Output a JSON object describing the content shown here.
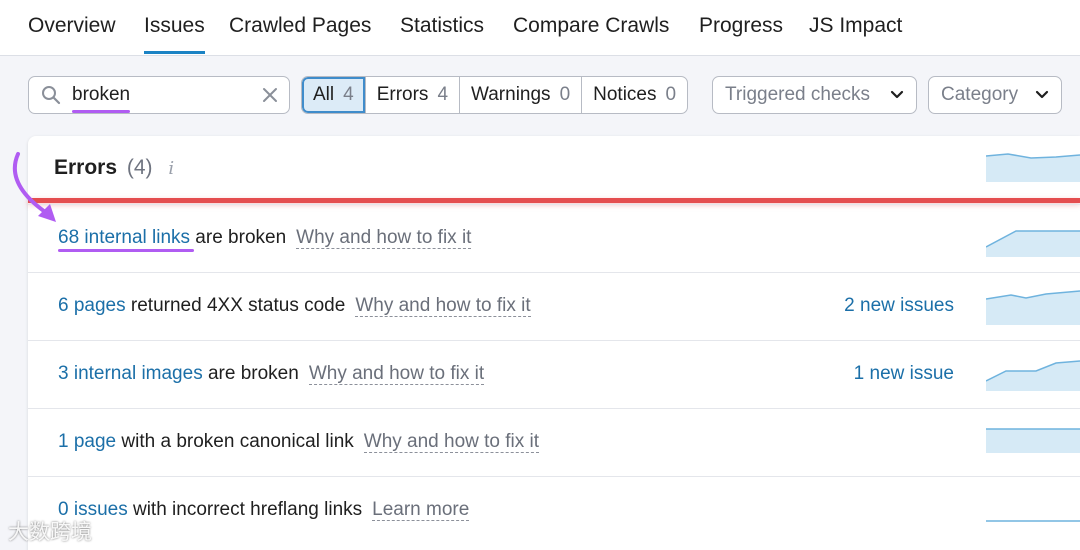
{
  "nav": {
    "tabs": [
      {
        "label": "Overview",
        "active": false
      },
      {
        "label": "Issues",
        "active": true
      },
      {
        "label": "Crawled Pages",
        "active": false
      },
      {
        "label": "Statistics",
        "active": false
      },
      {
        "label": "Compare Crawls",
        "active": false
      },
      {
        "label": "Progress",
        "active": false
      },
      {
        "label": "JS Impact",
        "active": false
      }
    ]
  },
  "filters": {
    "search_value": "broken",
    "segments": [
      {
        "label": "All",
        "count": "4",
        "active": true
      },
      {
        "label": "Errors",
        "count": "4",
        "active": false
      },
      {
        "label": "Warnings",
        "count": "0",
        "active": false
      },
      {
        "label": "Notices",
        "count": "0",
        "active": false
      }
    ],
    "triggered_checks": "Triggered checks",
    "category": "Category"
  },
  "errors_section": {
    "title": "Errors",
    "count": "(4)",
    "info_icon": "i"
  },
  "issues": [
    {
      "link": "68 internal links",
      "text": " are broken",
      "fix": "Why and how to fix it",
      "new": ""
    },
    {
      "link": "6 pages",
      "text": " returned 4XX status code",
      "fix": "Why and how to fix it",
      "new": "2 new issues"
    },
    {
      "link": "3 internal images",
      "text": " are broken",
      "fix": "Why and how to fix it",
      "new": "1 new issue"
    },
    {
      "link": "1 page",
      "text": " with a broken canonical link",
      "fix": "Why and how to fix it",
      "new": ""
    },
    {
      "link": "0 issues",
      "text": " with incorrect hreflang links",
      "fix": "Learn more",
      "new": ""
    }
  ],
  "watermark": "大数跨境",
  "colors": {
    "accent": "#1b83c4",
    "link": "#1b6fa8",
    "error_line": "#e44d4f",
    "highlight": "#b05cf2"
  }
}
